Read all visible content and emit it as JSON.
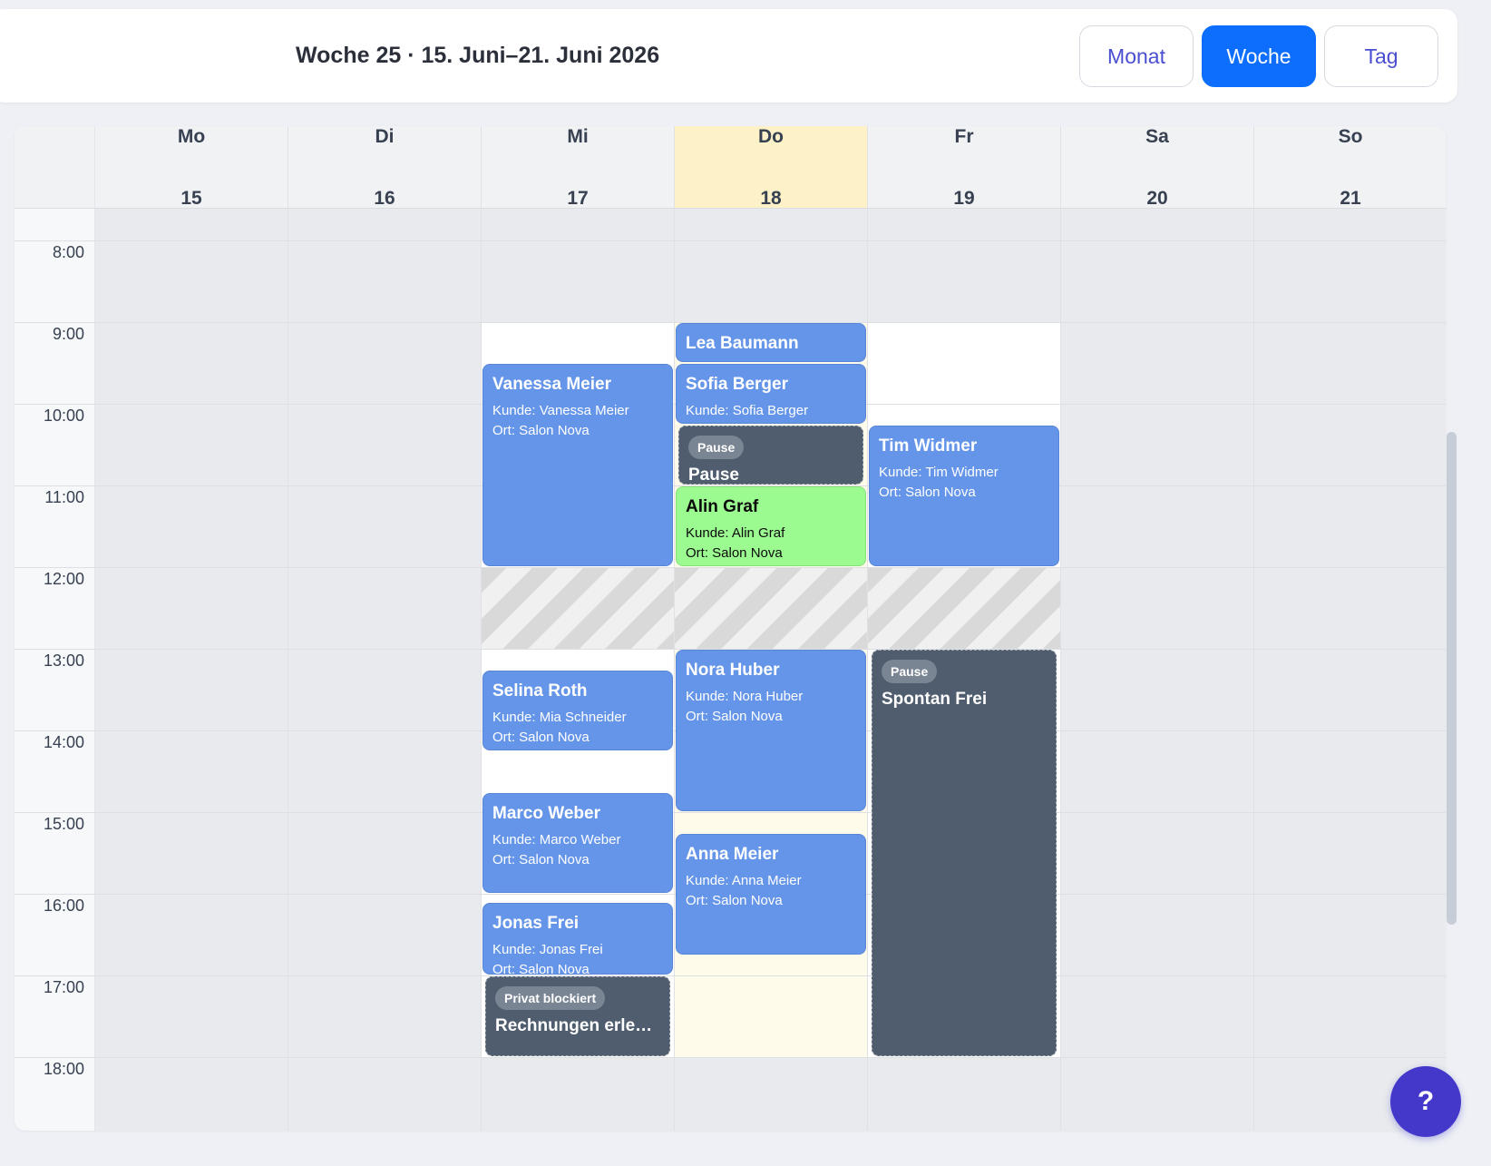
{
  "header": {
    "week_title": "Woche 25 · 15. Juni–21. Juni 2026",
    "views": [
      "Monat",
      "Woche",
      "Tag"
    ],
    "active_view": "Woche"
  },
  "days": [
    {
      "name": "Mo",
      "num": "15"
    },
    {
      "name": "Di",
      "num": "16"
    },
    {
      "name": "Mi",
      "num": "17"
    },
    {
      "name": "Do",
      "num": "18"
    },
    {
      "name": "Fr",
      "num": "19"
    },
    {
      "name": "Sa",
      "num": "20"
    },
    {
      "name": "So",
      "num": "21"
    }
  ],
  "today_index": 3,
  "hours": [
    "8:00",
    "9:00",
    "10:00",
    "11:00",
    "12:00",
    "13:00",
    "14:00",
    "15:00",
    "16:00",
    "17:00",
    "18:00"
  ],
  "events": [
    {
      "day": 2,
      "start": 9.5,
      "end": 12.0,
      "kind": "blue",
      "title": "Vanessa Meier",
      "kunde": "Kunde: Vanessa Meier",
      "ort": "Ort: Salon Nova"
    },
    {
      "day": 2,
      "start": 13.25,
      "end": 14.25,
      "kind": "blue",
      "title": "Selina Roth",
      "kunde": "Kunde: Mia Schneider",
      "ort": "Ort: Salon Nova"
    },
    {
      "day": 2,
      "start": 14.75,
      "end": 16.0,
      "kind": "blue",
      "title": "Marco Weber",
      "kunde": "Kunde: Marco Weber",
      "ort": "Ort: Salon Nova"
    },
    {
      "day": 2,
      "start": 16.1,
      "end": 17.0,
      "kind": "blue",
      "title": "Jonas Frei",
      "kunde": "Kunde: Jonas Frei",
      "ort": "Ort: Salon Nova"
    },
    {
      "day": 2,
      "start": 17.0,
      "end": 18.0,
      "kind": "dark",
      "badge": "Privat blockiert",
      "title": "Rechnungen erledigen"
    },
    {
      "day": 3,
      "start": 9.0,
      "end": 9.5,
      "kind": "blue",
      "title": "Lea Baumann"
    },
    {
      "day": 3,
      "start": 9.5,
      "end": 10.25,
      "kind": "blue",
      "title": "Sofia Berger",
      "kunde": "Kunde: Sofia Berger"
    },
    {
      "day": 3,
      "start": 10.25,
      "end": 11.0,
      "kind": "dark",
      "badge": "Pause",
      "title": "Pause"
    },
    {
      "day": 3,
      "start": 11.0,
      "end": 12.0,
      "kind": "green",
      "title": "Alin Graf",
      "kunde": "Kunde: Alin Graf",
      "ort": "Ort: Salon Nova"
    },
    {
      "day": 3,
      "start": 13.0,
      "end": 15.0,
      "kind": "blue",
      "title": "Nora Huber",
      "kunde": "Kunde: Nora Huber",
      "ort": "Ort: Salon Nova"
    },
    {
      "day": 3,
      "start": 15.25,
      "end": 16.75,
      "kind": "blue",
      "title": "Anna Meier",
      "kunde": "Kunde: Anna Meier",
      "ort": "Ort: Salon Nova"
    },
    {
      "day": 4,
      "start": 10.25,
      "end": 12.0,
      "kind": "blue",
      "title": "Tim Widmer",
      "kunde": "Kunde: Tim Widmer",
      "ort": "Ort: Salon Nova"
    },
    {
      "day": 4,
      "start": 13.0,
      "end": 18.0,
      "kind": "dark",
      "badge": "Pause",
      "title": "Spontan Frei"
    }
  ],
  "help": {
    "label": "?"
  },
  "colors": {
    "primary": "#0d6efd",
    "event_blue": "#6595e9",
    "event_green": "#9cfb90",
    "event_dark": "#4f5d6e",
    "today": "#fdf1c8"
  }
}
